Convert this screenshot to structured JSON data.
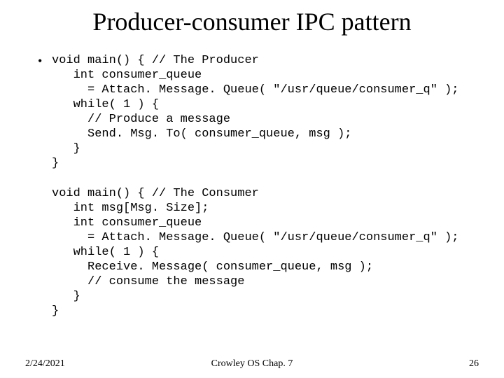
{
  "title": "Producer-consumer IPC pattern",
  "bullet": "•",
  "code1": "void main() { // The Producer\n   int consumer_queue\n     = Attach. Message. Queue( \"/usr/queue/consumer_q\" );\n   while( 1 ) {\n     // Produce a message\n     Send. Msg. To( consumer_queue, msg );\n   }\n}",
  "code2": "void main() { // The Consumer\n   int msg[Msg. Size];\n   int consumer_queue\n     = Attach. Message. Queue( \"/usr/queue/consumer_q\" );\n   while( 1 ) {\n     Receive. Message( consumer_queue, msg );\n     // consume the message\n   }\n}",
  "footer": {
    "date": "2/24/2021",
    "center": "Crowley   OS   Chap. 7",
    "page": "26"
  }
}
